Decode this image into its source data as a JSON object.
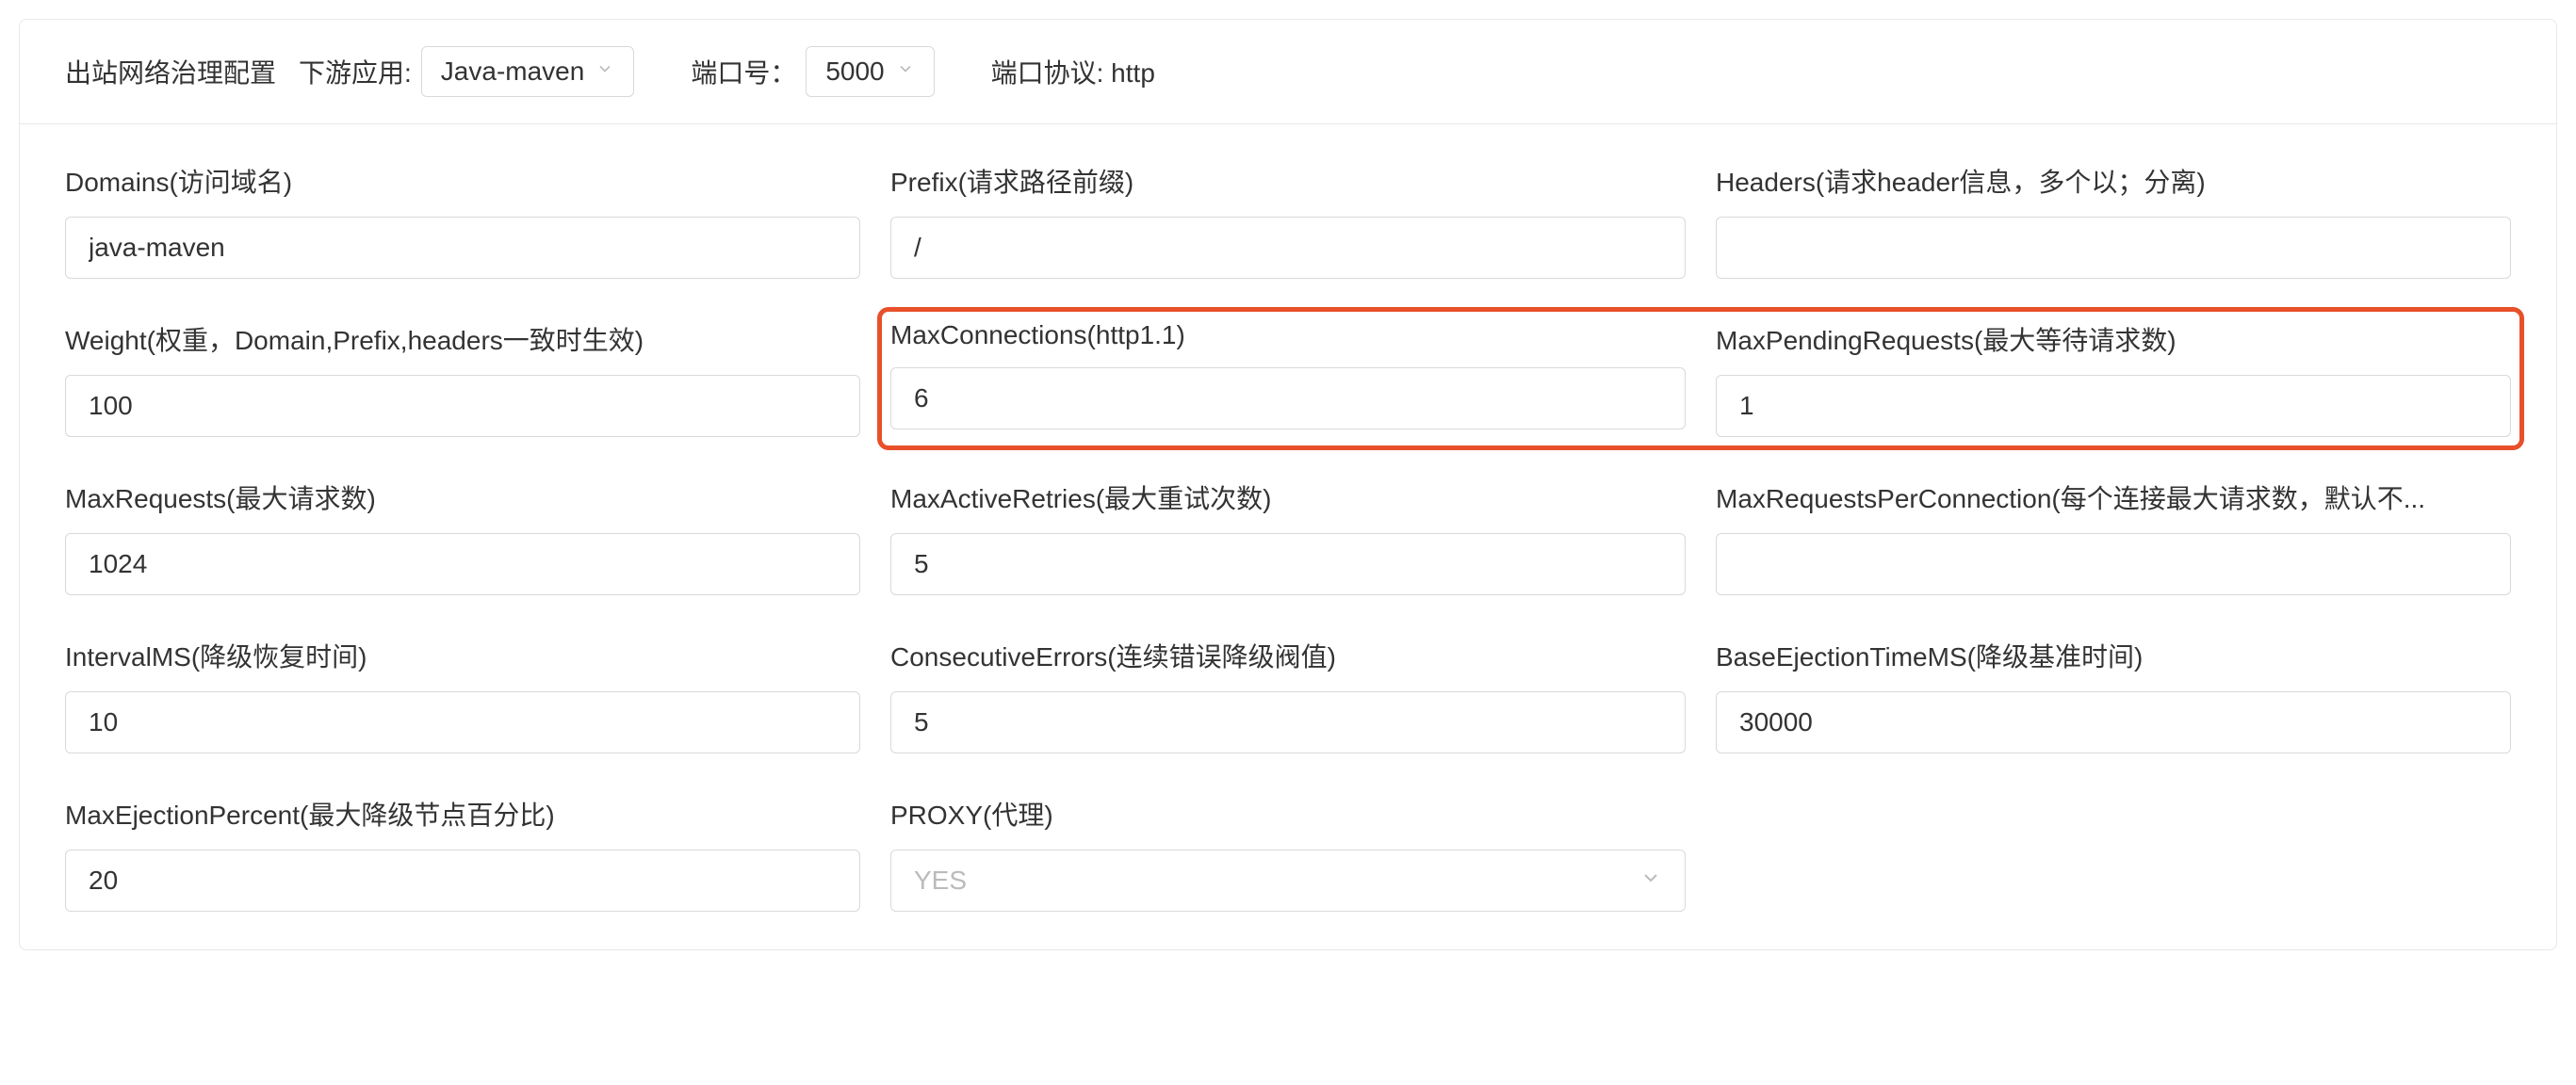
{
  "header": {
    "title": "出站网络治理配置",
    "downstream_label": "下游应用:",
    "downstream_value": "Java-maven",
    "port_label": "端口号：",
    "port_value": "5000",
    "protocol_label": "端口协议: http"
  },
  "fields": {
    "domains": {
      "label": "Domains(访问域名)",
      "value": "java-maven"
    },
    "prefix": {
      "label": "Prefix(请求路径前缀)",
      "value": "/"
    },
    "headers": {
      "label": "Headers(请求header信息，多个以；分离)",
      "value": ""
    },
    "weight": {
      "label": "Weight(权重，Domain,Prefix,headers一致时生效)",
      "value": "100"
    },
    "maxConnections": {
      "label": "MaxConnections(http1.1)",
      "value": "6"
    },
    "maxPendingRequests": {
      "label": "MaxPendingRequests(最大等待请求数)",
      "value": "1"
    },
    "maxRequests": {
      "label": "MaxRequests(最大请求数)",
      "value": "1024"
    },
    "maxActiveRetries": {
      "label": "MaxActiveRetries(最大重试次数)",
      "value": "5"
    },
    "maxRequestsPerConnection": {
      "label": "MaxRequestsPerConnection(每个连接最大请求数，默认不...",
      "value": ""
    },
    "intervalMS": {
      "label": "IntervalMS(降级恢复时间)",
      "value": "10"
    },
    "consecutiveErrors": {
      "label": "ConsecutiveErrors(连续错误降级阀值)",
      "value": "5"
    },
    "baseEjectionTimeMS": {
      "label": "BaseEjectionTimeMS(降级基准时间)",
      "value": "30000"
    },
    "maxEjectionPercent": {
      "label": "MaxEjectionPercent(最大降级节点百分比)",
      "value": "20"
    },
    "proxy": {
      "label": "PROXY(代理)",
      "value": "YES"
    }
  }
}
